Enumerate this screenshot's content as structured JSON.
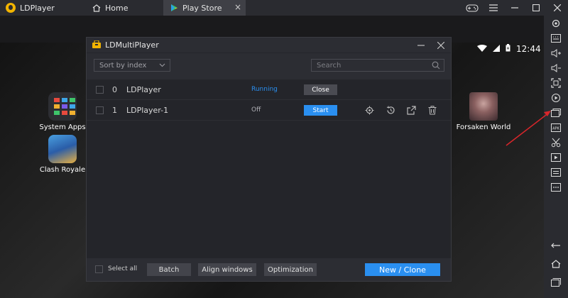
{
  "topbar": {
    "app_title": "LDPlayer",
    "tabs": [
      {
        "label": "Home"
      },
      {
        "label": "Play Store"
      }
    ]
  },
  "android": {
    "status_time": "12:44",
    "apps_left": [
      {
        "label": "System Apps",
        "icon": "system-apps-icon"
      },
      {
        "label": "Clash Royale",
        "icon": "clash-royale-icon"
      }
    ],
    "apps_right": [
      {
        "label": "Forsaken World",
        "icon": "forsaken-world-icon"
      }
    ]
  },
  "dialog": {
    "title": "LDMultiPlayer",
    "sort_label": "Sort by index",
    "search_placeholder": "Search",
    "instances": [
      {
        "index": "0",
        "name": "LDPlayer",
        "status": "Running",
        "action": "Close"
      },
      {
        "index": "1",
        "name": "LDPlayer-1",
        "status": "Off",
        "action": "Start"
      }
    ],
    "footer": {
      "select_all": "Select all",
      "batch": "Batch",
      "align": "Align windows",
      "optimization": "Optimization",
      "new_clone": "New / Clone"
    }
  },
  "colors": {
    "accent": "#2a8ff0",
    "running": "#2a8ff0",
    "arrow": "#d9262b"
  }
}
